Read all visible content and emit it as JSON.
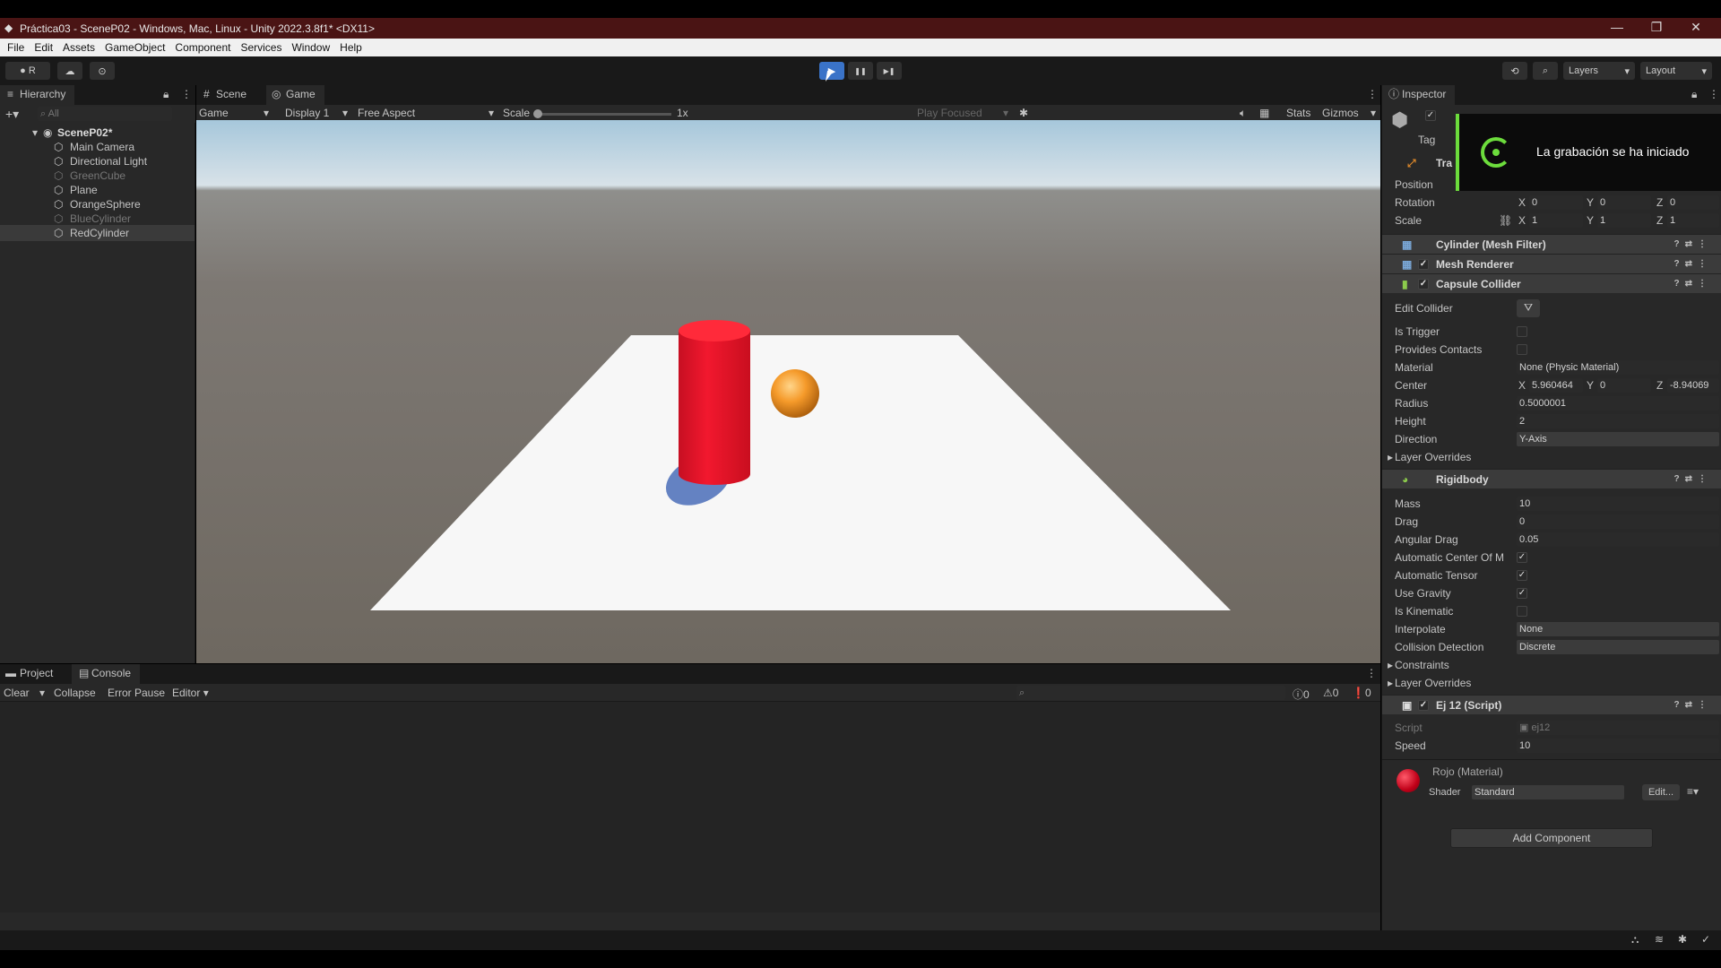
{
  "window": {
    "title": "Práctica03 - SceneP02 - Windows, Mac, Linux - Unity 2022.3.8f1* <DX11>",
    "minimize": "—",
    "maximize": "❐",
    "close": "✕"
  },
  "menu": [
    "File",
    "Edit",
    "Assets",
    "GameObject",
    "Component",
    "Services",
    "Window",
    "Help"
  ],
  "toolbar": {
    "account": "R",
    "layers": "Layers",
    "layout": "Layout",
    "play": "▶",
    "pause": "❚❚",
    "step": "▶❚"
  },
  "hierarchy": {
    "tab": "Hierarchy",
    "search_placeholder": "All",
    "scene": "SceneP02*",
    "items": [
      "Main Camera",
      "Directional Light",
      "GreenCube",
      "Plane",
      "OrangeSphere",
      "BlueCylinder",
      "RedCylinder"
    ]
  },
  "view": {
    "tabs": [
      "Scene",
      "Game"
    ],
    "game_label": "Game",
    "display": "Display 1",
    "aspect": "Free Aspect",
    "scale_label": "Scale",
    "scale_value": "1x",
    "play_focused": "Play Focused",
    "stats": "Stats",
    "gizmos": "Gizmos"
  },
  "console": {
    "tabs": [
      "Project",
      "Console"
    ],
    "clear": "Clear",
    "collapse": "Collapse",
    "error_pause": "Error Pause",
    "editor": "Editor",
    "count_log": "0",
    "count_warn": "0",
    "count_err": "0"
  },
  "inspector": {
    "tab": "Inspector",
    "tag_label": "Tag",
    "transform_label": "Tra",
    "position": "Position",
    "rotation": "Rotation",
    "scale": "Scale",
    "rot": {
      "x": "0",
      "y": "0",
      "z": "0"
    },
    "scl": {
      "x": "1",
      "y": "1",
      "z": "1"
    },
    "mesh_filter": "Cylinder (Mesh Filter)",
    "mesh_renderer": "Mesh Renderer",
    "capsule": "Capsule Collider",
    "capsule_fields": {
      "edit_collider": "Edit Collider",
      "is_trigger": "Is Trigger",
      "provides_contacts": "Provides Contacts",
      "material": "Material",
      "material_val": "None (Physic Material)",
      "center": "Center",
      "center_x": "5.960464",
      "center_y": "0",
      "center_z": "-8.94069",
      "radius": "Radius",
      "radius_val": "0.5000001",
      "height": "Height",
      "height_val": "2",
      "direction": "Direction",
      "direction_val": "Y-Axis",
      "layer_overrides": "Layer Overrides"
    },
    "rigidbody": "Rigidbody",
    "rb_fields": {
      "mass": "Mass",
      "mass_val": "10",
      "drag": "Drag",
      "drag_val": "0",
      "angular_drag": "Angular Drag",
      "angular_drag_val": "0.05",
      "auto_center": "Automatic Center Of M",
      "auto_tensor": "Automatic Tensor",
      "use_gravity": "Use Gravity",
      "is_kinematic": "Is Kinematic",
      "interpolate": "Interpolate",
      "interpolate_val": "None",
      "collision": "Collision Detection",
      "collision_val": "Discrete",
      "constraints": "Constraints",
      "layer_overrides": "Layer Overrides"
    },
    "script_comp": "Ej 12 (Script)",
    "script_label": "Script",
    "script_val": "ej12",
    "speed": "Speed",
    "speed_val": "10",
    "material_name": "Rojo (Material)",
    "shader_label": "Shader",
    "shader_val": "Standard",
    "edit_btn": "Edit...",
    "add_component": "Add Component"
  },
  "notification": {
    "text": "La grabación se ha iniciado"
  },
  "axes": {
    "x": "X",
    "y": "Y",
    "z": "Z"
  },
  "colors": {
    "red_cylinder": "#e8142a",
    "orange_sphere": "#f59a2a",
    "play_active": "#3a73c8"
  }
}
